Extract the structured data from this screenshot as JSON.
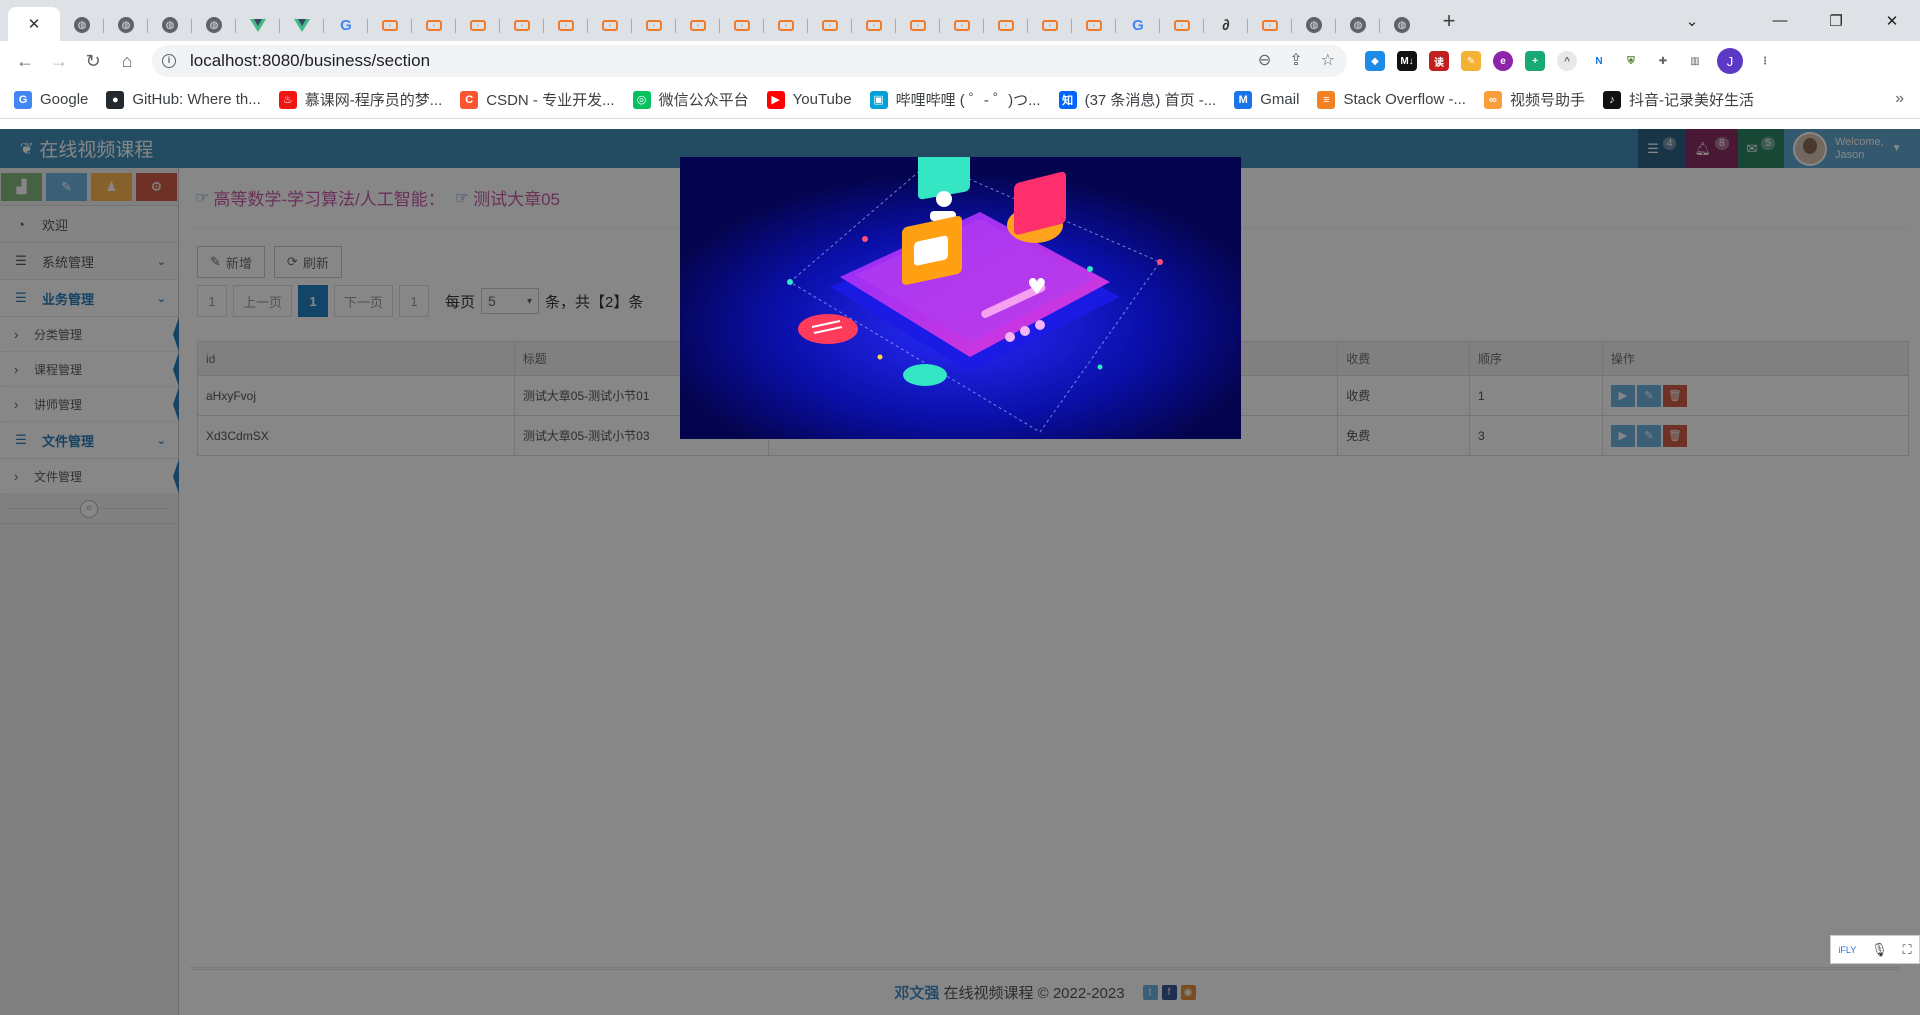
{
  "browser": {
    "tab_favicons": [
      "close",
      "globe",
      "globe",
      "globe",
      "globe",
      "vue",
      "vue",
      "google",
      "csdn",
      "csdn",
      "csdn",
      "csdn",
      "csdn",
      "csdn",
      "csdn",
      "csdn",
      "csdn",
      "csdn",
      "csdn",
      "csdn",
      "csdn",
      "csdn",
      "csdn",
      "csdn",
      "csdn",
      "google",
      "csdn",
      "math",
      "csdn",
      "globe",
      "globe",
      "globe"
    ],
    "url": "localhost:8080/business/section",
    "bookmarks": [
      {
        "label": "Google",
        "icon": "G",
        "color": "#4285f4"
      },
      {
        "label": "GitHub: Where th...",
        "icon": "●",
        "color": "#24292f"
      },
      {
        "label": "慕课网-程序员的梦...",
        "icon": "♨",
        "color": "#f01414"
      },
      {
        "label": "CSDN - 专业开发...",
        "icon": "C",
        "color": "#fc5531"
      },
      {
        "label": "微信公众平台",
        "icon": "◎",
        "color": "#07c160"
      },
      {
        "label": "YouTube",
        "icon": "▶",
        "color": "#ff0000"
      },
      {
        "label": "哔哩哔哩 ( ゜- ゜)つ...",
        "icon": "▣",
        "color": "#00a1d6"
      },
      {
        "label": "(37 条消息) 首页 -...",
        "icon": "知",
        "color": "#0066ff"
      },
      {
        "label": "Gmail",
        "icon": "M",
        "color": "#1a73e8"
      },
      {
        "label": "Stack Overflow -...",
        "icon": "≡",
        "color": "#f48024"
      },
      {
        "label": "视频号助手",
        "icon": "∞",
        "color": "#fa9d3b"
      },
      {
        "label": "抖音-记录美好生活",
        "icon": "♪",
        "color": "#111111"
      }
    ],
    "bookmarks_more": "»",
    "profile_initial": "J"
  },
  "app": {
    "brand": "在线视频课程",
    "nav": {
      "tasks_count": "4",
      "notifications_count": "8",
      "messages_count": "5",
      "welcome": "Welcome,",
      "user": "Jason"
    },
    "sidebar": {
      "menus": [
        {
          "label": "欢迎",
          "icon": "tachometer-icon",
          "open": false,
          "arrow": false
        },
        {
          "label": "系统管理",
          "icon": "list-icon",
          "open": false,
          "arrow": true
        },
        {
          "label": "业务管理",
          "icon": "list-icon",
          "open": true,
          "arrow": true,
          "sub": [
            "分类管理",
            "课程管理",
            "讲师管理"
          ]
        },
        {
          "label": "文件管理",
          "icon": "list-icon",
          "open": true,
          "arrow": true,
          "sub": [
            "文件管理"
          ]
        }
      ]
    },
    "breadcrumb": {
      "course": "高等数学-学习算法/人工智能：",
      "chapter": "测试大章05"
    },
    "buttons": {
      "add": "新增",
      "refresh": "刷新"
    },
    "pager": {
      "first": "1",
      "prev": "上一页",
      "current": "1",
      "next": "下一页",
      "last": "1",
      "per_page_label": "每页",
      "per_page": "5",
      "total_text": "条，共【2】条"
    },
    "table": {
      "headers": [
        "id",
        "标题",
        "",
        "收费",
        "顺序",
        "操作"
      ],
      "rows": [
        {
          "id": "aHxyFvoj",
          "title": "测试大章05-测试小节01",
          "charge": "收费",
          "sort": "1"
        },
        {
          "id": "Xd3CdmSX",
          "title": "测试大章05-测试小节03",
          "charge": "免费",
          "sort": "3"
        }
      ]
    },
    "footer": {
      "author": "邓文强",
      "text": "在线视频课程 © 2022-2023"
    }
  },
  "colors": {
    "navbar": "#438eb9",
    "accent": "#2b7dbc",
    "breadcrumb": "#c75da9",
    "video_btn": "#6fb3e0",
    "edit_btn": "#6fb3e0",
    "delete_btn": "#d15b47"
  }
}
